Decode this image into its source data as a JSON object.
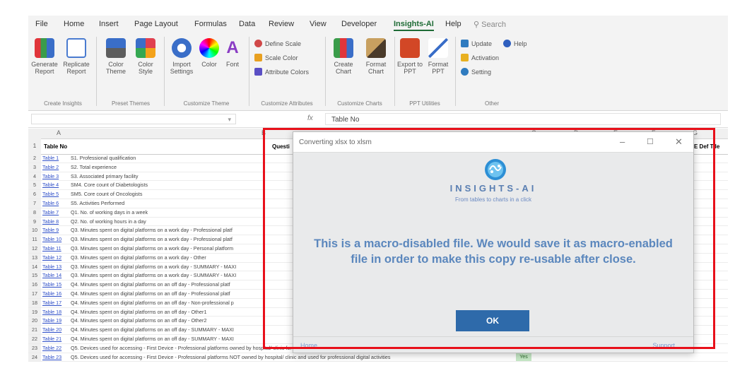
{
  "menu": [
    "File",
    "Home",
    "Insert",
    "Page Layout",
    "Formulas",
    "Data",
    "Review",
    "View",
    "Developer",
    "Insights-AI",
    "Help"
  ],
  "menu_active": "Insights-AI",
  "search_label": "Search",
  "ribbon": {
    "generate": "Generate Report",
    "replicate": "Replicate Report",
    "color_theme": "Color Theme",
    "color_style": "Color Style",
    "import_settings": "Import Settings",
    "color": "Color",
    "font": "Font",
    "define_scale": "Define Scale",
    "scale_color": "Scale Color",
    "attribute_colors": "Attribute Colors",
    "create_chart": "Create Chart",
    "format_chart": "Format Chart",
    "export_ppt": "Export to PPT",
    "format_ppt": "Format PPT",
    "update": "Update",
    "activation": "Activation",
    "setting": "Setting",
    "help": "Help",
    "groups": [
      "Create Insights",
      "Preset Themes",
      "Customize Theme",
      "Customize Attributes",
      "Customize Charts",
      "PPT Utilities",
      "Other"
    ]
  },
  "formula_bar": {
    "value": "Table No"
  },
  "columns": [
    "A",
    "B",
    "C",
    "D",
    "E",
    "F",
    "G"
  ],
  "sheet": {
    "header_a": "Table No",
    "header_b": "Questi",
    "header_h": "E Def Tile",
    "rows": [
      {
        "num": "2",
        "link": "Table 1",
        "q": "S1. Professional qualification"
      },
      {
        "num": "3",
        "link": "Table 2",
        "q": "S2. Total experience"
      },
      {
        "num": "4",
        "link": "Table 3",
        "q": "S3. Associated primary facility"
      },
      {
        "num": "5",
        "link": "Table 4",
        "q": "SM4. Core count of Diabetologists"
      },
      {
        "num": "6",
        "link": "Table 5",
        "q": "SM5. Core count of Oncologists"
      },
      {
        "num": "7",
        "link": "Table 6",
        "q": "S5. Activities Performed"
      },
      {
        "num": "8",
        "link": "Table 7",
        "q": "Q1. No. of working days in a week"
      },
      {
        "num": "9",
        "link": "Table 8",
        "q": "Q2. No. of working hours in a day"
      },
      {
        "num": "10",
        "link": "Table 9",
        "q": "Q3. Minutes spent on digital platforms on a work day - Professional platf"
      },
      {
        "num": "11",
        "link": "Table 10",
        "q": "Q3. Minutes spent on digital platforms on a work day - Professional platf"
      },
      {
        "num": "12",
        "link": "Table 11",
        "q": "Q3. Minutes spent on digital platforms on a work day - Personal platform"
      },
      {
        "num": "13",
        "link": "Table 12",
        "q": "Q3. Minutes spent on digital platforms on a work day - Other"
      },
      {
        "num": "14",
        "link": "Table 13",
        "q": "Q3. Minutes spent on digital platforms on a work day - SUMMARY - MAXI"
      },
      {
        "num": "15",
        "link": "Table 14",
        "q": "Q3. Minutes spent on digital platforms on a work day - SUMMARY - MAXI"
      },
      {
        "num": "16",
        "link": "Table 15",
        "q": "Q4. Minutes spent on digital platforms on an off day - Professional platf"
      },
      {
        "num": "17",
        "link": "Table 16",
        "q": "Q4. Minutes spent on digital platforms on an off day - Professional platf"
      },
      {
        "num": "18",
        "link": "Table 17",
        "q": "Q4. Minutes spent on digital platforms on an off day - Non-professional p"
      },
      {
        "num": "19",
        "link": "Table 18",
        "q": "Q4. Minutes spent on digital platforms on an off day - Other1"
      },
      {
        "num": "20",
        "link": "Table 19",
        "q": "Q4. Minutes spent on digital platforms on an off day - Other2"
      },
      {
        "num": "21",
        "link": "Table 20",
        "q": "Q4. Minutes spent on digital platforms on an off day - SUMMARY - MAXI"
      },
      {
        "num": "22",
        "link": "Table 21",
        "q": "Q4. Minutes spent on digital platforms on an off day - SUMMARY - MAXI"
      },
      {
        "num": "23",
        "link": "Table 22",
        "q": "Q5. Devices used for accessing - First Device - Professional platforms owned by hospital/ clinic for administration or patient management purpose"
      },
      {
        "num": "24",
        "link": "Table 23",
        "q": "Q5. Devices used for accessing - First Device - Professional platforms NOT owned by hospital/ clinic and used for professional digital activities"
      }
    ],
    "yes_label": "Yes"
  },
  "dialog": {
    "title": "Converting xlsx to xlsm",
    "logo_text": "INSIGHTS-AI",
    "tagline": "From tables to charts in a click",
    "message": "This is a macro-disabled file. We would save it as macro-enabled file in order to make this copy re-usable after close.",
    "ok_label": "OK",
    "footer_left": "Home",
    "footer_right": "Support"
  },
  "colors": {
    "accent": "#2e6aaa",
    "message": "#5b87bd",
    "highlight": "#e8101a",
    "active_tab": "#1e6b35"
  }
}
